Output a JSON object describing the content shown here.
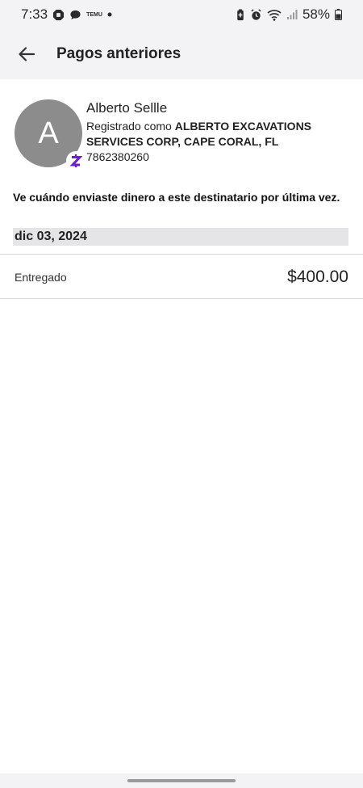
{
  "status_bar": {
    "time": "7:33",
    "temu_label": "TEMU",
    "battery": "58%"
  },
  "header": {
    "title": "Pagos anteriores"
  },
  "recipient": {
    "initial": "A",
    "name": "Alberto Sellle",
    "registered_prefix": "Registrado como ",
    "registered_name": "ALBERTO EXCAVATIONS SERVICES CORP, CAPE CORAL, FL",
    "phone": "7862380260"
  },
  "description": "Ve cuándo enviaste dinero a este destinatario por última vez.",
  "payments": [
    {
      "date": "dic 03, 2024",
      "status": "Entregado",
      "amount": "$400.00"
    }
  ],
  "colors": {
    "background": "#ffffff",
    "header_bg": "#f3f3f5",
    "avatar_bg": "#8c8c8c",
    "zelle_purple": "#6d1ed4",
    "date_header_bg": "#e5e5e7"
  }
}
